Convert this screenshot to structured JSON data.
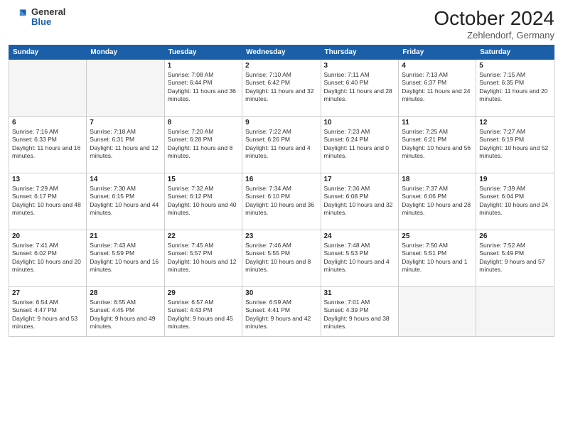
{
  "header": {
    "logo": {
      "general": "General",
      "blue": "Blue"
    },
    "title": "October 2024",
    "location": "Zehlendorf, Germany"
  },
  "weekdays": [
    "Sunday",
    "Monday",
    "Tuesday",
    "Wednesday",
    "Thursday",
    "Friday",
    "Saturday"
  ],
  "weeks": [
    [
      {
        "day": "",
        "info": ""
      },
      {
        "day": "",
        "info": ""
      },
      {
        "day": "1",
        "info": "Sunrise: 7:08 AM\nSunset: 6:44 PM\nDaylight: 11 hours and 36 minutes."
      },
      {
        "day": "2",
        "info": "Sunrise: 7:10 AM\nSunset: 6:42 PM\nDaylight: 11 hours and 32 minutes."
      },
      {
        "day": "3",
        "info": "Sunrise: 7:11 AM\nSunset: 6:40 PM\nDaylight: 11 hours and 28 minutes."
      },
      {
        "day": "4",
        "info": "Sunrise: 7:13 AM\nSunset: 6:37 PM\nDaylight: 11 hours and 24 minutes."
      },
      {
        "day": "5",
        "info": "Sunrise: 7:15 AM\nSunset: 6:35 PM\nDaylight: 11 hours and 20 minutes."
      }
    ],
    [
      {
        "day": "6",
        "info": "Sunrise: 7:16 AM\nSunset: 6:33 PM\nDaylight: 11 hours and 16 minutes."
      },
      {
        "day": "7",
        "info": "Sunrise: 7:18 AM\nSunset: 6:31 PM\nDaylight: 11 hours and 12 minutes."
      },
      {
        "day": "8",
        "info": "Sunrise: 7:20 AM\nSunset: 6:28 PM\nDaylight: 11 hours and 8 minutes."
      },
      {
        "day": "9",
        "info": "Sunrise: 7:22 AM\nSunset: 6:26 PM\nDaylight: 11 hours and 4 minutes."
      },
      {
        "day": "10",
        "info": "Sunrise: 7:23 AM\nSunset: 6:24 PM\nDaylight: 11 hours and 0 minutes."
      },
      {
        "day": "11",
        "info": "Sunrise: 7:25 AM\nSunset: 6:21 PM\nDaylight: 10 hours and 56 minutes."
      },
      {
        "day": "12",
        "info": "Sunrise: 7:27 AM\nSunset: 6:19 PM\nDaylight: 10 hours and 52 minutes."
      }
    ],
    [
      {
        "day": "13",
        "info": "Sunrise: 7:29 AM\nSunset: 6:17 PM\nDaylight: 10 hours and 48 minutes."
      },
      {
        "day": "14",
        "info": "Sunrise: 7:30 AM\nSunset: 6:15 PM\nDaylight: 10 hours and 44 minutes."
      },
      {
        "day": "15",
        "info": "Sunrise: 7:32 AM\nSunset: 6:12 PM\nDaylight: 10 hours and 40 minutes."
      },
      {
        "day": "16",
        "info": "Sunrise: 7:34 AM\nSunset: 6:10 PM\nDaylight: 10 hours and 36 minutes."
      },
      {
        "day": "17",
        "info": "Sunrise: 7:36 AM\nSunset: 6:08 PM\nDaylight: 10 hours and 32 minutes."
      },
      {
        "day": "18",
        "info": "Sunrise: 7:37 AM\nSunset: 6:06 PM\nDaylight: 10 hours and 28 minutes."
      },
      {
        "day": "19",
        "info": "Sunrise: 7:39 AM\nSunset: 6:04 PM\nDaylight: 10 hours and 24 minutes."
      }
    ],
    [
      {
        "day": "20",
        "info": "Sunrise: 7:41 AM\nSunset: 6:02 PM\nDaylight: 10 hours and 20 minutes."
      },
      {
        "day": "21",
        "info": "Sunrise: 7:43 AM\nSunset: 5:59 PM\nDaylight: 10 hours and 16 minutes."
      },
      {
        "day": "22",
        "info": "Sunrise: 7:45 AM\nSunset: 5:57 PM\nDaylight: 10 hours and 12 minutes."
      },
      {
        "day": "23",
        "info": "Sunrise: 7:46 AM\nSunset: 5:55 PM\nDaylight: 10 hours and 8 minutes."
      },
      {
        "day": "24",
        "info": "Sunrise: 7:48 AM\nSunset: 5:53 PM\nDaylight: 10 hours and 4 minutes."
      },
      {
        "day": "25",
        "info": "Sunrise: 7:50 AM\nSunset: 5:51 PM\nDaylight: 10 hours and 1 minute."
      },
      {
        "day": "26",
        "info": "Sunrise: 7:52 AM\nSunset: 5:49 PM\nDaylight: 9 hours and 57 minutes."
      }
    ],
    [
      {
        "day": "27",
        "info": "Sunrise: 6:54 AM\nSunset: 4:47 PM\nDaylight: 9 hours and 53 minutes."
      },
      {
        "day": "28",
        "info": "Sunrise: 6:55 AM\nSunset: 4:45 PM\nDaylight: 9 hours and 49 minutes."
      },
      {
        "day": "29",
        "info": "Sunrise: 6:57 AM\nSunset: 4:43 PM\nDaylight: 9 hours and 45 minutes."
      },
      {
        "day": "30",
        "info": "Sunrise: 6:59 AM\nSunset: 4:41 PM\nDaylight: 9 hours and 42 minutes."
      },
      {
        "day": "31",
        "info": "Sunrise: 7:01 AM\nSunset: 4:39 PM\nDaylight: 9 hours and 38 minutes."
      },
      {
        "day": "",
        "info": ""
      },
      {
        "day": "",
        "info": ""
      }
    ]
  ]
}
